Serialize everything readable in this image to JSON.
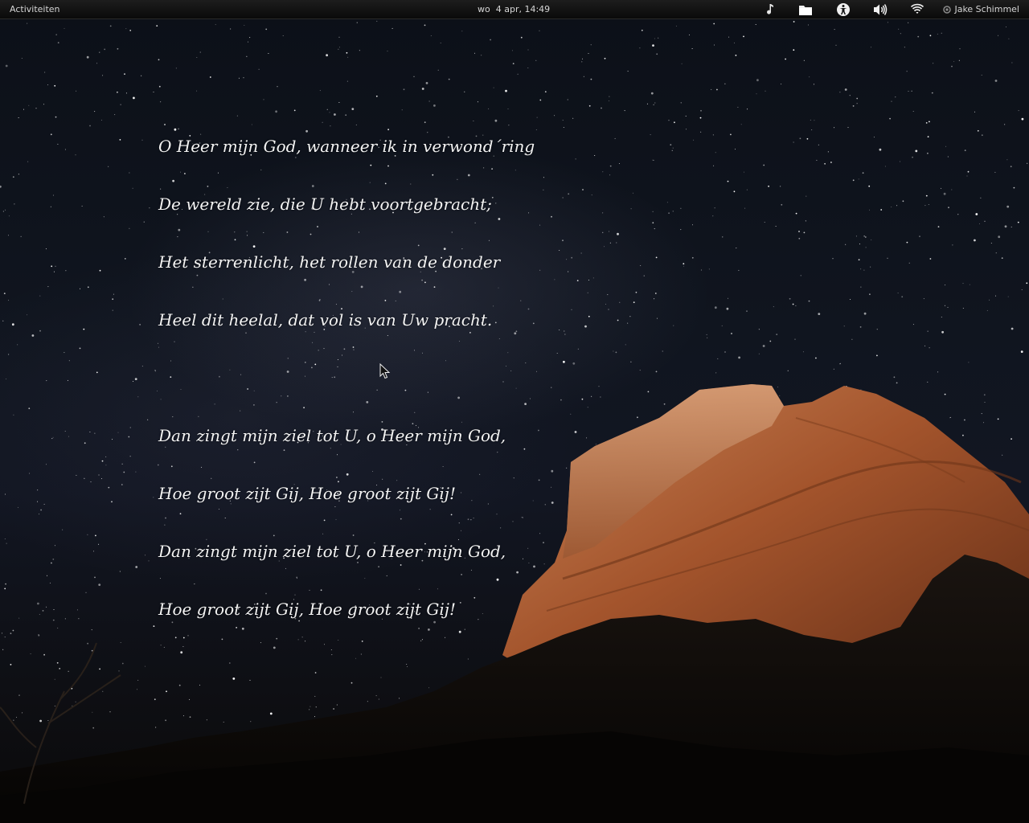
{
  "panel": {
    "activities_label": "Activiteiten",
    "clock": "wo  4 apr, 14:49",
    "user_name": "Jake Schimmel",
    "tray_icons": [
      "music-note-icon",
      "folder-icon",
      "accessibility-icon",
      "volume-icon",
      "wifi-icon"
    ]
  },
  "poem": {
    "stanza1": [
      "O Heer mijn God, wanneer ik in verwond´ring",
      "De wereld zie, die U hebt voortgebracht;",
      "Het sterrenlicht, het rollen van de donder",
      "Heel dit heelal, dat vol is van Uw pracht."
    ],
    "stanza2": [
      "Dan zingt mijn ziel tot U, o Heer mijn God,",
      "Hoe groot zijt Gij, Hoe groot zijt Gij!",
      "Dan zingt mijn ziel tot U, o Heer mijn God,",
      "Hoe groot zijt Gij, Hoe groot zijt Gij!"
    ]
  },
  "colors": {
    "panel_bg": "#0a0a0a",
    "panel_text": "#d6d6d6",
    "poem_text": "#f3f3f3",
    "rock": "#a8572e",
    "sky": "#10151f"
  }
}
